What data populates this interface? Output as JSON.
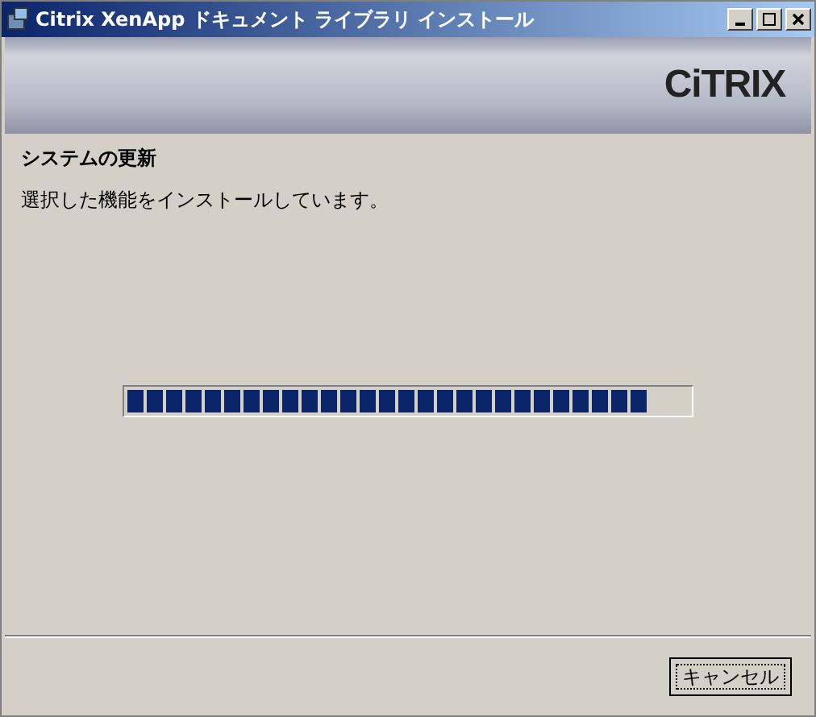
{
  "window": {
    "title": "Citrix XenApp ドキュメント ライブラリ インストール"
  },
  "banner": {
    "logo": "CiTRIX"
  },
  "heading": "システムの更新",
  "description": "選択した機能をインストールしています。",
  "progress": {
    "level": 0.93
  },
  "buttons": [
    {
      "label": "キャンセル",
      "focused": true
    }
  ]
}
